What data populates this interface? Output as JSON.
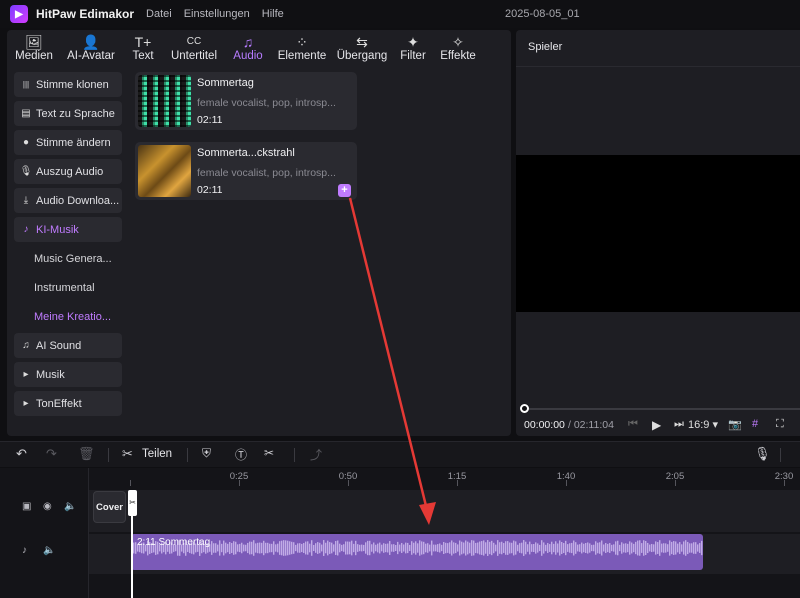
{
  "app": {
    "name": "HitPaw Edimakor",
    "project_name": "2025-08-05_01",
    "logo_glyph": "▶"
  },
  "menu": [
    "Datei",
    "Einstellungen",
    "Hilfe"
  ],
  "top_tabs": [
    {
      "label": "Medien",
      "icon": "media-icon",
      "glyph": "🖼"
    },
    {
      "label": "AI-Avatar",
      "icon": "avatar-icon",
      "glyph": "👤"
    },
    {
      "label": "Text",
      "icon": "text-icon",
      "glyph": "T+"
    },
    {
      "label": "Untertitel",
      "icon": "subtitle-icon",
      "glyph": "CC"
    },
    {
      "label": "Audio",
      "icon": "audio-icon",
      "glyph": "♫",
      "active": true
    },
    {
      "label": "Elemente",
      "icon": "elements-icon",
      "glyph": "⁘"
    },
    {
      "label": "Übergang",
      "icon": "transition-icon",
      "glyph": "⇆"
    },
    {
      "label": "Filter",
      "icon": "filter-icon",
      "glyph": "✦"
    },
    {
      "label": "Effekte",
      "icon": "effects-icon",
      "glyph": "✧"
    }
  ],
  "sidebar": {
    "items": [
      {
        "label": "Stimme klonen",
        "glyph": "|||"
      },
      {
        "label": "Text zu Sprache",
        "glyph": "▤"
      },
      {
        "label": "Stimme ändern",
        "glyph": "●"
      },
      {
        "label": "Auszug Audio",
        "glyph": "🎙"
      },
      {
        "label": "Audio Downloa...",
        "glyph": "⤓"
      },
      {
        "label": "KI-Musik",
        "glyph": "♪",
        "active": true
      }
    ],
    "subitems": [
      {
        "label": "Music Genera..."
      },
      {
        "label": "Instrumental"
      },
      {
        "label": "Meine Kreatio...",
        "active": true
      }
    ],
    "items_after": [
      {
        "label": "AI Sound",
        "glyph": "♫"
      },
      {
        "label": "Musik",
        "glyph": "▸"
      },
      {
        "label": "TonEffekt",
        "glyph": "▸"
      }
    ]
  },
  "tracks_list": [
    {
      "title": "Sommertag",
      "desc": "female vocalist, pop, introsp...",
      "duration": "02:11"
    },
    {
      "title": "Sommerta...ckstrahl",
      "desc": "female vocalist, pop, introsp...",
      "duration": "02:11"
    }
  ],
  "player": {
    "title": "Spieler",
    "current_time": "00:00:00",
    "total_time": "/ 02:11:04",
    "aspect": "16:9",
    "progress": 0
  },
  "timeline_toolbar": {
    "split_label": "Teilen"
  },
  "ruler": [
    "0:25",
    "0:50",
    "1:15",
    "1:40",
    "2:05",
    "2:30"
  ],
  "timeline": {
    "cover_label": "Cover",
    "clip_label": "2:11 Sommertag"
  },
  "colors": {
    "accent": "#c07cff",
    "clip": "#7b5ab8",
    "arrow": "#e53935"
  }
}
